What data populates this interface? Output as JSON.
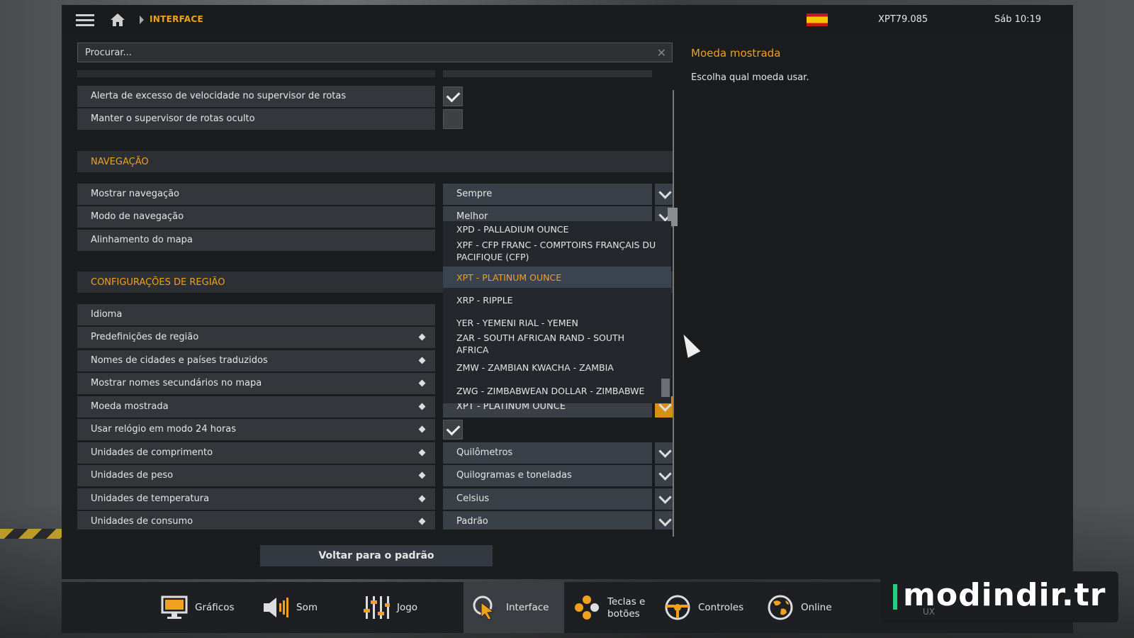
{
  "topbar": {
    "breadcrumb": "INTERFACE",
    "money": "XPT79.085",
    "clock": "Sáb 10:19"
  },
  "search": {
    "placeholder": "Procurar..."
  },
  "settings": {
    "route_speed_alert": "Alerta de excesso de velocidade no supervisor de rotas",
    "route_hidden": "Manter o supervisor de rotas oculto",
    "nav_section": "NAVEGAÇÃO",
    "show_nav": "Mostrar navegação",
    "show_nav_value": "Sempre",
    "nav_mode": "Modo de navegação",
    "nav_mode_value": "Melhor",
    "map_align": "Alinhamento do mapa",
    "region_section": "CONFIGURAÇÕES DE REGIÃO",
    "language": "Idioma",
    "region_presets": "Predefinições de região",
    "translated_names": "Nomes de cidades e países traduzidos",
    "secondary_names": "Mostrar nomes secundários no mapa",
    "currency": "Moeda mostrada",
    "currency_value": "XPT - PLATINUM OUNCE",
    "clock24": "Usar relógio em modo 24 horas",
    "length_units": "Unidades de comprimento",
    "length_value": "Quilômetros",
    "weight_units": "Unidades de peso",
    "weight_value": "Quilogramas e toneladas",
    "temp_units": "Unidades de temperatura",
    "temp_value": "Celsius",
    "consumption_units": "Unidades de consumo",
    "consumption_value": "Padrão"
  },
  "dropdown": {
    "items": [
      "XPD - PALLADIUM OUNCE",
      "XPF - CFP FRANC - COMPTOIRS FRANÇAIS DU PACIFIQUE (CFP)",
      "XPT - PLATINUM OUNCE",
      "XRP - RIPPLE",
      "YER - YEMENI RIAL - YEMEN",
      "ZAR - SOUTH AFRICAN RAND - SOUTH AFRICA",
      "ZMW - ZAMBIAN KWACHA - ZAMBIA",
      "ZWG - ZIMBABWEAN DOLLAR - ZIMBABWE"
    ],
    "selected_index": 2
  },
  "info": {
    "title": "Moeda mostrada",
    "description": "Escolha qual moeda usar."
  },
  "reset_label": "Voltar para o padrão",
  "tabs": [
    {
      "label": "Gráficos",
      "icon": "monitor-icon"
    },
    {
      "label": "Som",
      "icon": "speaker-icon"
    },
    {
      "label": "Jogo",
      "icon": "sliders-icon"
    },
    {
      "label": "Interface",
      "icon": "cursor-icon",
      "active": true
    },
    {
      "label": "Teclas e botões",
      "icon": "buttons-icon"
    },
    {
      "label": "Controles",
      "icon": "steering-wheel-icon"
    },
    {
      "label": "Online",
      "icon": "globe-icon"
    }
  ],
  "watermark": {
    "text": "modindir.tr",
    "sub": "UX"
  },
  "colors": {
    "accent": "#f0a21e",
    "panel": "#1a1c1e",
    "row": "#33363a",
    "control": "#3a4048"
  }
}
